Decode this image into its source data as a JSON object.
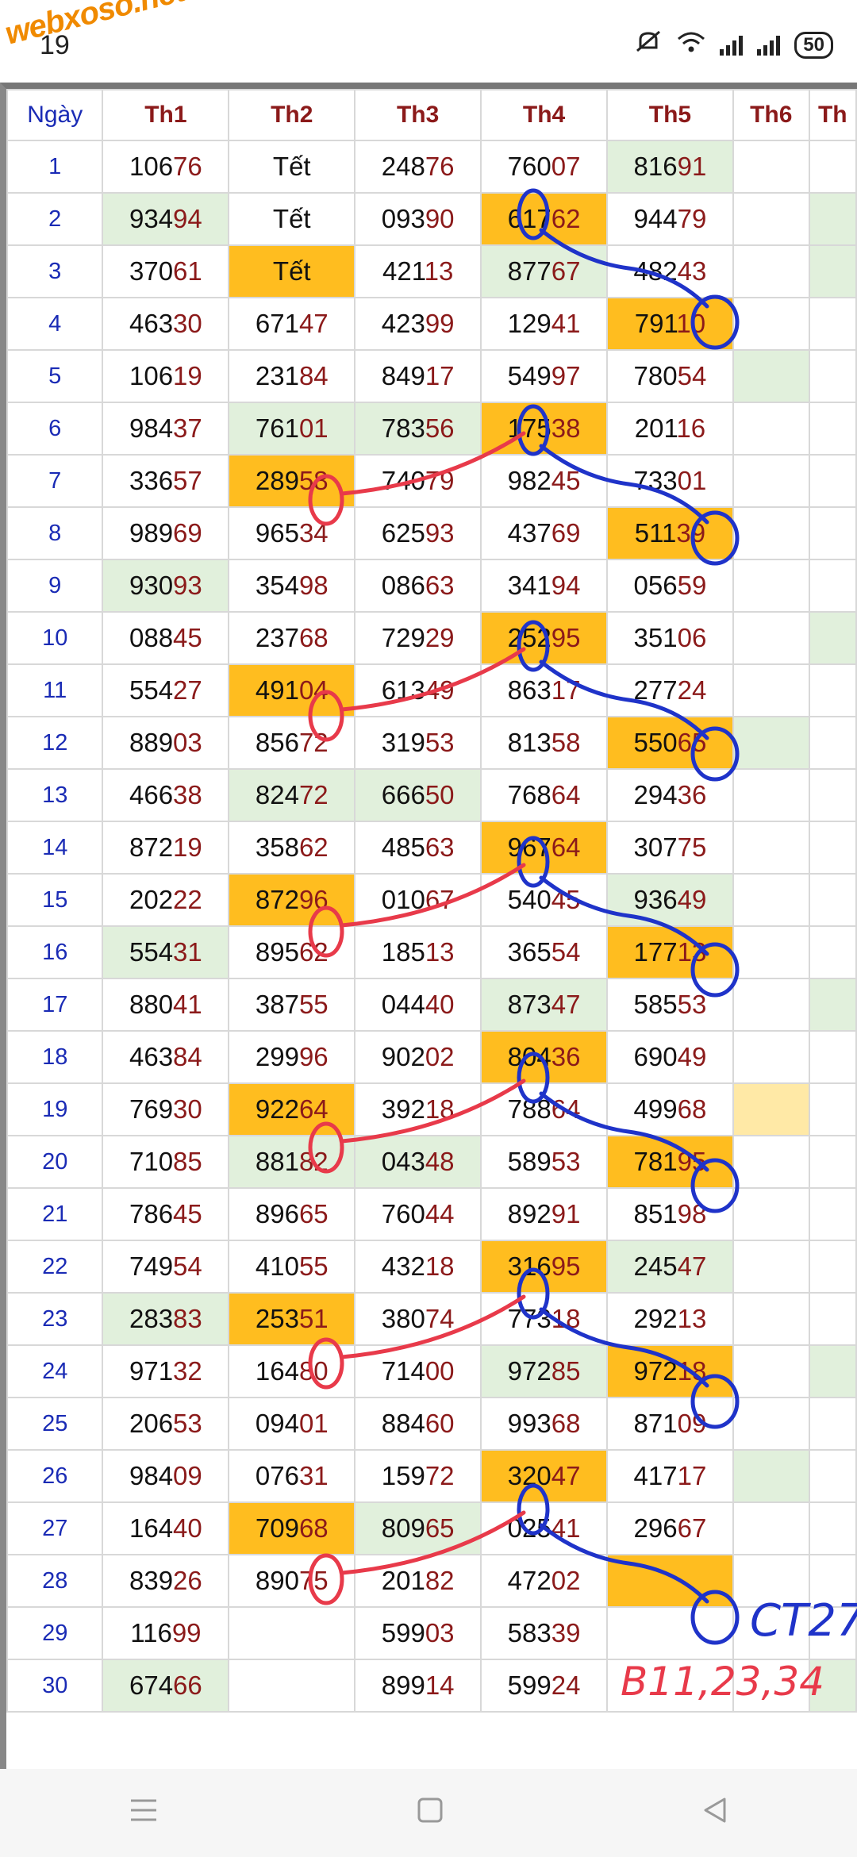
{
  "status_bar": {
    "time": "19",
    "watermark": "webxoso.net",
    "battery": "50"
  },
  "table": {
    "headers": [
      "Ngày",
      "Th1",
      "Th2",
      "Th3",
      "Th4",
      "Th5",
      "Th6",
      "Th"
    ],
    "rows": [
      {
        "day": "1",
        "cells": [
          {
            "v": "10676",
            "c": ""
          },
          {
            "v": "Tết",
            "c": ""
          },
          {
            "v": "24876",
            "c": ""
          },
          {
            "v": "76007",
            "c": ""
          },
          {
            "v": "81691",
            "c": "green"
          },
          {
            "v": "",
            "c": ""
          },
          {
            "v": "",
            "c": ""
          }
        ]
      },
      {
        "day": "2",
        "cells": [
          {
            "v": "93494",
            "c": "green"
          },
          {
            "v": "Tết",
            "c": ""
          },
          {
            "v": "09390",
            "c": ""
          },
          {
            "v": "61762",
            "c": "orange"
          },
          {
            "v": "94479",
            "c": ""
          },
          {
            "v": "",
            "c": ""
          },
          {
            "v": "",
            "c": "green"
          }
        ]
      },
      {
        "day": "3",
        "cells": [
          {
            "v": "37061",
            "c": ""
          },
          {
            "v": "Tết",
            "c": "orange"
          },
          {
            "v": "42113",
            "c": ""
          },
          {
            "v": "87767",
            "c": "green"
          },
          {
            "v": "48243",
            "c": ""
          },
          {
            "v": "",
            "c": ""
          },
          {
            "v": "",
            "c": "green"
          }
        ]
      },
      {
        "day": "4",
        "cells": [
          {
            "v": "46330",
            "c": ""
          },
          {
            "v": "67147",
            "c": ""
          },
          {
            "v": "42399",
            "c": ""
          },
          {
            "v": "12941",
            "c": ""
          },
          {
            "v": "79110",
            "c": "orange"
          },
          {
            "v": "",
            "c": ""
          },
          {
            "v": "",
            "c": ""
          }
        ]
      },
      {
        "day": "5",
        "cells": [
          {
            "v": "10619",
            "c": ""
          },
          {
            "v": "23184",
            "c": ""
          },
          {
            "v": "84917",
            "c": ""
          },
          {
            "v": "54997",
            "c": ""
          },
          {
            "v": "78054",
            "c": ""
          },
          {
            "v": "",
            "c": "green"
          },
          {
            "v": "",
            "c": ""
          }
        ]
      },
      {
        "day": "6",
        "cells": [
          {
            "v": "98437",
            "c": ""
          },
          {
            "v": "76101",
            "c": "green"
          },
          {
            "v": "78356",
            "c": "green"
          },
          {
            "v": "17538",
            "c": "orange"
          },
          {
            "v": "20116",
            "c": ""
          },
          {
            "v": "",
            "c": ""
          },
          {
            "v": "",
            "c": ""
          }
        ]
      },
      {
        "day": "7",
        "cells": [
          {
            "v": "33657",
            "c": ""
          },
          {
            "v": "28958",
            "c": "orange"
          },
          {
            "v": "74079",
            "c": ""
          },
          {
            "v": "98245",
            "c": ""
          },
          {
            "v": "73301",
            "c": ""
          },
          {
            "v": "",
            "c": ""
          },
          {
            "v": "",
            "c": ""
          }
        ]
      },
      {
        "day": "8",
        "cells": [
          {
            "v": "98969",
            "c": ""
          },
          {
            "v": "96534",
            "c": ""
          },
          {
            "v": "62593",
            "c": ""
          },
          {
            "v": "43769",
            "c": ""
          },
          {
            "v": "51139",
            "c": "orange"
          },
          {
            "v": "",
            "c": ""
          },
          {
            "v": "",
            "c": ""
          }
        ]
      },
      {
        "day": "9",
        "cells": [
          {
            "v": "93093",
            "c": "green"
          },
          {
            "v": "35498",
            "c": ""
          },
          {
            "v": "08663",
            "c": ""
          },
          {
            "v": "34194",
            "c": ""
          },
          {
            "v": "05659",
            "c": ""
          },
          {
            "v": "",
            "c": ""
          },
          {
            "v": "",
            "c": ""
          }
        ]
      },
      {
        "day": "10",
        "cells": [
          {
            "v": "08845",
            "c": ""
          },
          {
            "v": "23768",
            "c": ""
          },
          {
            "v": "72929",
            "c": ""
          },
          {
            "v": "25295",
            "c": "orange"
          },
          {
            "v": "35106",
            "c": ""
          },
          {
            "v": "",
            "c": ""
          },
          {
            "v": "",
            "c": "green"
          }
        ]
      },
      {
        "day": "11",
        "cells": [
          {
            "v": "55427",
            "c": ""
          },
          {
            "v": "49104",
            "c": "orange"
          },
          {
            "v": "61349",
            "c": ""
          },
          {
            "v": "86317",
            "c": ""
          },
          {
            "v": "27724",
            "c": ""
          },
          {
            "v": "",
            "c": ""
          },
          {
            "v": "",
            "c": ""
          }
        ]
      },
      {
        "day": "12",
        "cells": [
          {
            "v": "88903",
            "c": ""
          },
          {
            "v": "85672",
            "c": ""
          },
          {
            "v": "31953",
            "c": ""
          },
          {
            "v": "81358",
            "c": ""
          },
          {
            "v": "55065",
            "c": "orange"
          },
          {
            "v": "",
            "c": "green"
          },
          {
            "v": "",
            "c": ""
          }
        ]
      },
      {
        "day": "13",
        "cells": [
          {
            "v": "46638",
            "c": ""
          },
          {
            "v": "82472",
            "c": "green"
          },
          {
            "v": "66650",
            "c": "green"
          },
          {
            "v": "76864",
            "c": ""
          },
          {
            "v": "29436",
            "c": ""
          },
          {
            "v": "",
            "c": ""
          },
          {
            "v": "",
            "c": ""
          }
        ]
      },
      {
        "day": "14",
        "cells": [
          {
            "v": "87219",
            "c": ""
          },
          {
            "v": "35862",
            "c": ""
          },
          {
            "v": "48563",
            "c": ""
          },
          {
            "v": "96764",
            "c": "orange"
          },
          {
            "v": "30775",
            "c": ""
          },
          {
            "v": "",
            "c": ""
          },
          {
            "v": "",
            "c": ""
          }
        ]
      },
      {
        "day": "15",
        "cells": [
          {
            "v": "20222",
            "c": ""
          },
          {
            "v": "87296",
            "c": "orange"
          },
          {
            "v": "01067",
            "c": ""
          },
          {
            "v": "54045",
            "c": ""
          },
          {
            "v": "93649",
            "c": "green"
          },
          {
            "v": "",
            "c": ""
          },
          {
            "v": "",
            "c": ""
          }
        ]
      },
      {
        "day": "16",
        "cells": [
          {
            "v": "55431",
            "c": "green"
          },
          {
            "v": "89562",
            "c": ""
          },
          {
            "v": "18513",
            "c": ""
          },
          {
            "v": "36554",
            "c": ""
          },
          {
            "v": "17713",
            "c": "orange"
          },
          {
            "v": "",
            "c": ""
          },
          {
            "v": "",
            "c": ""
          }
        ]
      },
      {
        "day": "17",
        "cells": [
          {
            "v": "88041",
            "c": ""
          },
          {
            "v": "38755",
            "c": ""
          },
          {
            "v": "04440",
            "c": ""
          },
          {
            "v": "87347",
            "c": "green"
          },
          {
            "v": "58553",
            "c": ""
          },
          {
            "v": "",
            "c": ""
          },
          {
            "v": "",
            "c": "green"
          }
        ]
      },
      {
        "day": "18",
        "cells": [
          {
            "v": "46384",
            "c": ""
          },
          {
            "v": "29996",
            "c": ""
          },
          {
            "v": "90202",
            "c": ""
          },
          {
            "v": "80436",
            "c": "orange"
          },
          {
            "v": "69049",
            "c": ""
          },
          {
            "v": "",
            "c": ""
          },
          {
            "v": "",
            "c": ""
          }
        ]
      },
      {
        "day": "19",
        "cells": [
          {
            "v": "76930",
            "c": ""
          },
          {
            "v": "92264",
            "c": "orange"
          },
          {
            "v": "39218",
            "c": ""
          },
          {
            "v": "78864",
            "c": ""
          },
          {
            "v": "49968",
            "c": ""
          },
          {
            "v": "",
            "c": "lightyellow"
          },
          {
            "v": "",
            "c": ""
          }
        ]
      },
      {
        "day": "20",
        "cells": [
          {
            "v": "71085",
            "c": ""
          },
          {
            "v": "88182",
            "c": "green"
          },
          {
            "v": "04348",
            "c": "green"
          },
          {
            "v": "58953",
            "c": ""
          },
          {
            "v": "78195",
            "c": "orange"
          },
          {
            "v": "",
            "c": ""
          },
          {
            "v": "",
            "c": ""
          }
        ]
      },
      {
        "day": "21",
        "cells": [
          {
            "v": "78645",
            "c": ""
          },
          {
            "v": "89665",
            "c": ""
          },
          {
            "v": "76044",
            "c": ""
          },
          {
            "v": "89291",
            "c": ""
          },
          {
            "v": "85198",
            "c": ""
          },
          {
            "v": "",
            "c": ""
          },
          {
            "v": "",
            "c": ""
          }
        ]
      },
      {
        "day": "22",
        "cells": [
          {
            "v": "74954",
            "c": ""
          },
          {
            "v": "41055",
            "c": ""
          },
          {
            "v": "43218",
            "c": ""
          },
          {
            "v": "31695",
            "c": "orange"
          },
          {
            "v": "24547",
            "c": "green"
          },
          {
            "v": "",
            "c": ""
          },
          {
            "v": "",
            "c": ""
          }
        ]
      },
      {
        "day": "23",
        "cells": [
          {
            "v": "28383",
            "c": "green"
          },
          {
            "v": "25351",
            "c": "orange"
          },
          {
            "v": "38074",
            "c": ""
          },
          {
            "v": "77318",
            "c": ""
          },
          {
            "v": "29213",
            "c": ""
          },
          {
            "v": "",
            "c": ""
          },
          {
            "v": "",
            "c": ""
          }
        ]
      },
      {
        "day": "24",
        "cells": [
          {
            "v": "97132",
            "c": ""
          },
          {
            "v": "16480",
            "c": ""
          },
          {
            "v": "71400",
            "c": ""
          },
          {
            "v": "97285",
            "c": "green"
          },
          {
            "v": "97218",
            "c": "orange"
          },
          {
            "v": "",
            "c": ""
          },
          {
            "v": "",
            "c": "green"
          }
        ]
      },
      {
        "day": "25",
        "cells": [
          {
            "v": "20653",
            "c": ""
          },
          {
            "v": "09401",
            "c": ""
          },
          {
            "v": "88460",
            "c": ""
          },
          {
            "v": "99368",
            "c": ""
          },
          {
            "v": "87109",
            "c": ""
          },
          {
            "v": "",
            "c": ""
          },
          {
            "v": "",
            "c": ""
          }
        ]
      },
      {
        "day": "26",
        "cells": [
          {
            "v": "98409",
            "c": ""
          },
          {
            "v": "07631",
            "c": ""
          },
          {
            "v": "15972",
            "c": ""
          },
          {
            "v": "32047",
            "c": "orange"
          },
          {
            "v": "41717",
            "c": ""
          },
          {
            "v": "",
            "c": "green"
          },
          {
            "v": "",
            "c": ""
          }
        ]
      },
      {
        "day": "27",
        "cells": [
          {
            "v": "16440",
            "c": ""
          },
          {
            "v": "70968",
            "c": "orange"
          },
          {
            "v": "80965",
            "c": "green"
          },
          {
            "v": "02541",
            "c": ""
          },
          {
            "v": "29667",
            "c": ""
          },
          {
            "v": "",
            "c": ""
          },
          {
            "v": "",
            "c": ""
          }
        ]
      },
      {
        "day": "28",
        "cells": [
          {
            "v": "83926",
            "c": ""
          },
          {
            "v": "89075",
            "c": ""
          },
          {
            "v": "20182",
            "c": ""
          },
          {
            "v": "47202",
            "c": ""
          },
          {
            "v": "",
            "c": "orange"
          },
          {
            "v": "",
            "c": ""
          },
          {
            "v": "",
            "c": ""
          }
        ]
      },
      {
        "day": "29",
        "cells": [
          {
            "v": "11699",
            "c": ""
          },
          {
            "v": "",
            "c": ""
          },
          {
            "v": "59903",
            "c": ""
          },
          {
            "v": "58339",
            "c": ""
          },
          {
            "v": "",
            "c": ""
          },
          {
            "v": "",
            "c": ""
          },
          {
            "v": "",
            "c": ""
          }
        ]
      },
      {
        "day": "30",
        "cells": [
          {
            "v": "67466",
            "c": "green"
          },
          {
            "v": "",
            "c": ""
          },
          {
            "v": "89914",
            "c": ""
          },
          {
            "v": "59924",
            "c": ""
          },
          {
            "v": "",
            "c": ""
          },
          {
            "v": "",
            "c": ""
          },
          {
            "v": "",
            "c": "green"
          }
        ]
      }
    ]
  },
  "annotations": {
    "ct_note": "CT27",
    "b_note": "B11,23,34",
    "blue_color": "#1f33c9",
    "red_color": "#e83a4a"
  },
  "colors": {
    "orange": "#ffbd1f",
    "green": "#e1f0dc",
    "day_blue": "#1a2bb5",
    "header_red": "#8b1a1a"
  },
  "navbar": {
    "menu_icon": "menu-icon",
    "home_icon": "home-icon",
    "back_icon": "back-icon"
  }
}
